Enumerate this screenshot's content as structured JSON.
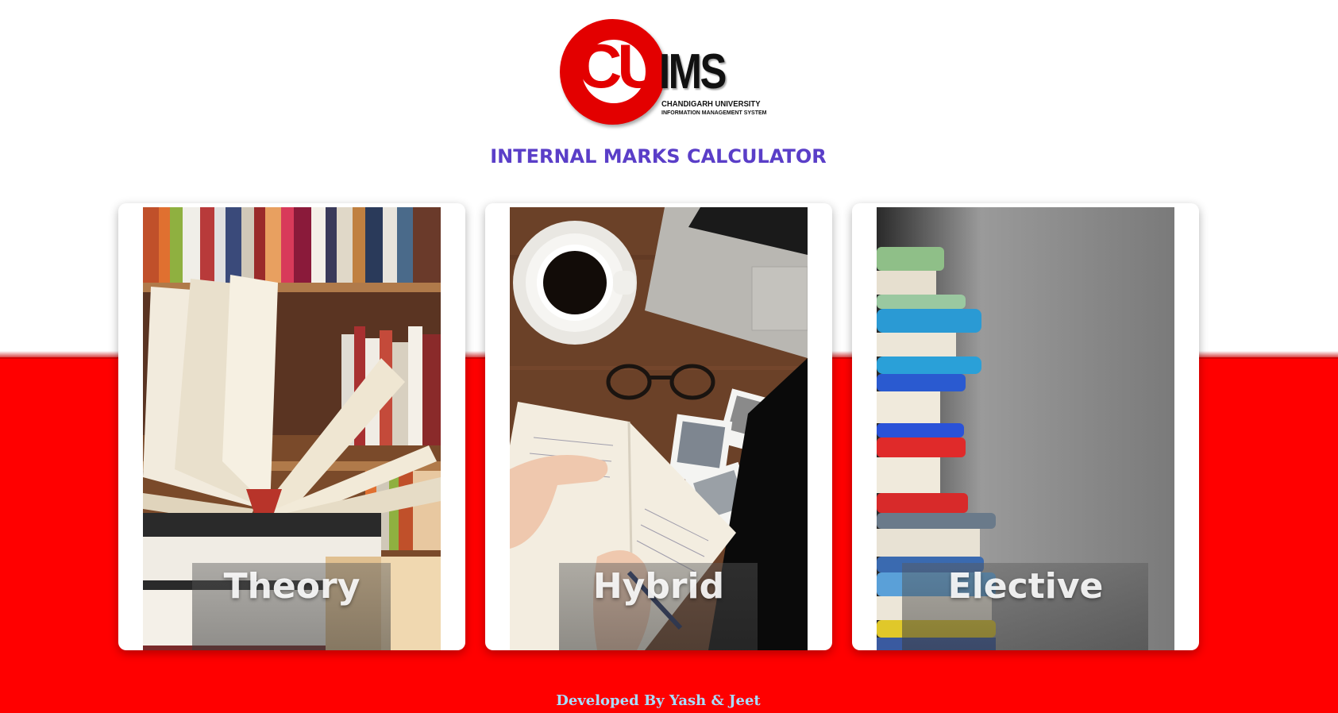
{
  "logo": {
    "mark": "CU",
    "name": "IMS",
    "line1": "CHANDIGARH UNIVERSITY",
    "line2": "INFORMATION MANAGEMENT SYSTEM"
  },
  "title": "INTERNAL MARKS CALCULATOR",
  "cards": [
    {
      "label": "Theory",
      "image": "open-books-on-shelf"
    },
    {
      "label": "Hybrid",
      "image": "desk-with-coffee-laptop-notebook"
    },
    {
      "label": "Elective",
      "image": "stack-of-books"
    }
  ],
  "footer": "Developed By Yash & Jeet",
  "colors": {
    "accent_title": "#5a3ec8",
    "band_red": "#ff0000",
    "logo_red": "#e30000",
    "footer_text": "#a8ddff"
  }
}
